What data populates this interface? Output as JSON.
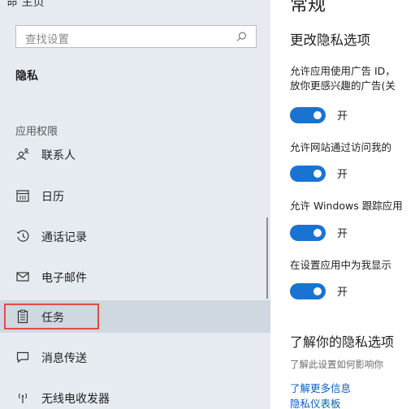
{
  "sidebar": {
    "top_clipped": "命 主页",
    "search": {
      "placeholder": "查找设置"
    },
    "section_title": "隐私",
    "group_label": "应用权限",
    "items": [
      {
        "label": "联系人",
        "icon": "contacts-icon"
      },
      {
        "label": "日历",
        "icon": "calendar-icon"
      },
      {
        "label": "通话记录",
        "icon": "call-history-icon"
      },
      {
        "label": "电子邮件",
        "icon": "email-icon"
      },
      {
        "label": "任务",
        "icon": "tasks-icon",
        "selected": true
      },
      {
        "label": "消息传送",
        "icon": "messaging-icon"
      },
      {
        "label": "无线电收发器",
        "icon": "radio-icon"
      }
    ]
  },
  "main": {
    "page_title": "常规",
    "section_title": "更改隐私选项",
    "options": [
      {
        "desc_line1": "允许应用使用广告 ID，",
        "desc_line2": "放你更感兴趣的广告(关",
        "state": "开"
      },
      {
        "desc_line1": "允许网站通过访问我的",
        "state": "开"
      },
      {
        "desc_line1": "允许 Windows 跟踪应用",
        "state": "开"
      },
      {
        "desc_line1": "在设置应用中为我显示",
        "state": "开"
      }
    ],
    "learn_title": "了解你的隐私选项",
    "learn_desc": "了解此设置如何影响你",
    "links": [
      "了解更多信息",
      "隐私仪表板"
    ]
  },
  "colors": {
    "accent": "#1a73d1",
    "sidebar_bg": "#e6ebf1",
    "highlight": "#e24a4a",
    "link": "#0a5fbf"
  }
}
